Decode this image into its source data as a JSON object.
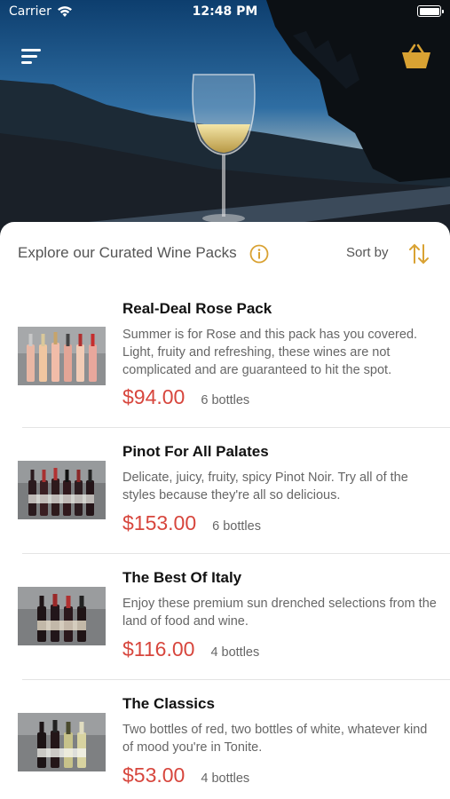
{
  "status_bar": {
    "carrier": "Carrier",
    "time": "12:48 PM"
  },
  "header": {
    "menu_icon": "hamburger-menu-icon",
    "cart_icon": "basket-icon",
    "accent_color": "#d9a233"
  },
  "section": {
    "title": "Explore our Curated Wine Packs",
    "info_icon": "info-circle-icon",
    "sort_label": "Sort by",
    "sort_icon": "sort-arrows-icon"
  },
  "packs": [
    {
      "name": "Real-Deal Rose Pack",
      "description": "Summer is for Rose and this pack has you covered. Light, fruity and refreshing, these wines are not complicated and are guaranteed to hit the spot.",
      "price": "$94.00",
      "bottles": "6 bottles"
    },
    {
      "name": "Pinot For All Palates",
      "description": "Delicate, juicy, fruity, spicy Pinot Noir. Try all of the styles because they're all so delicious.",
      "price": "$153.00",
      "bottles": "6 bottles"
    },
    {
      "name": "The Best Of Italy",
      "description": "Enjoy these premium sun drenched selections from the land of food and wine.",
      "price": "$116.00",
      "bottles": "4 bottles"
    },
    {
      "name": "The Classics",
      "description": "Two bottles of red, two bottles of white, whatever kind of mood you're in Tonite.",
      "price": "$53.00",
      "bottles": "4 bottles"
    }
  ],
  "colors": {
    "price": "#d7463d",
    "accent": "#d9a233"
  }
}
